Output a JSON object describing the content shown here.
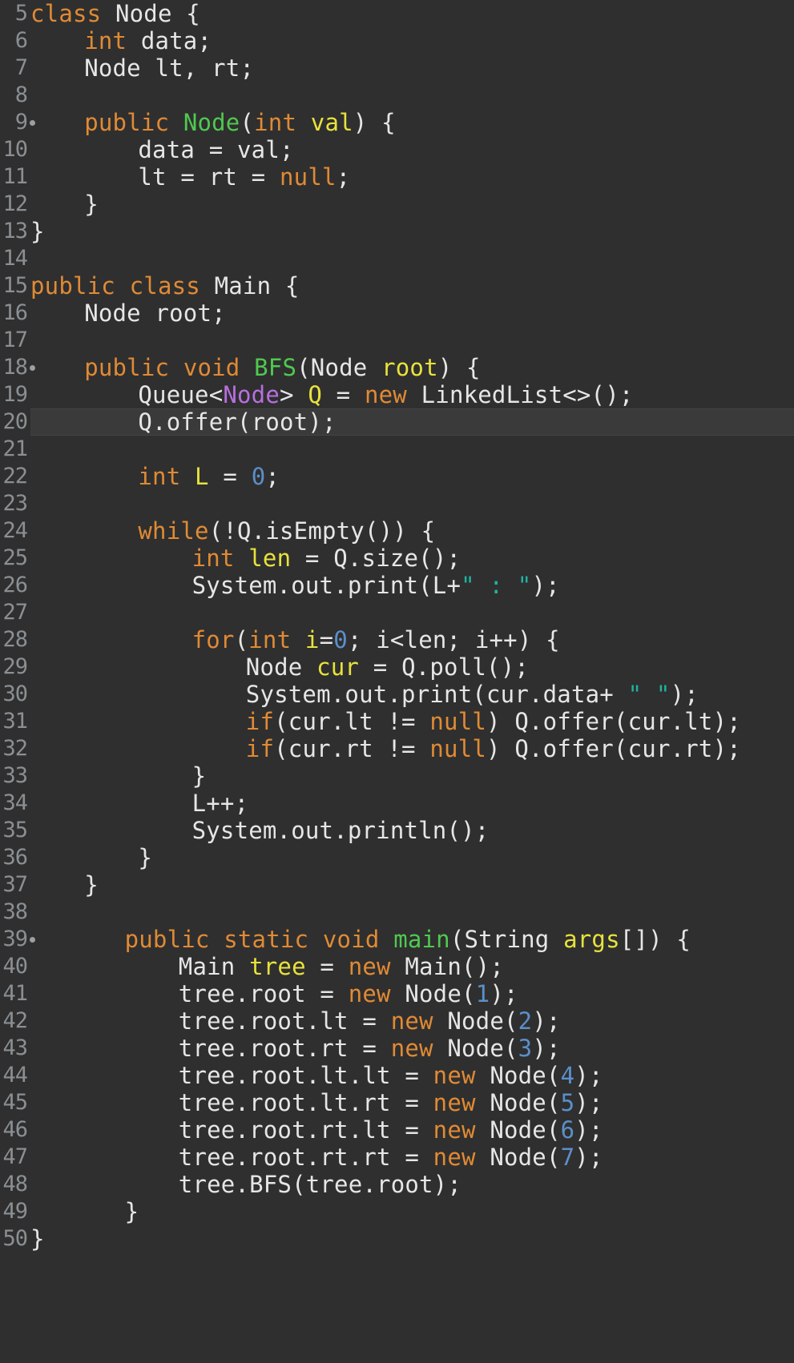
{
  "app": "code-editor",
  "colors": {
    "background": "#2f2f2f",
    "plain": "#e6e6e6",
    "keyword": "#e08a35",
    "method": "#4fc94f",
    "variable": "#e8e23c",
    "type": "#b86fe0",
    "number": "#5b8fc9",
    "string": "#20b2a0",
    "line_number": "#8a8f93"
  },
  "lines": [
    {
      "n": "5",
      "fold": false,
      "hl": false,
      "indent": 0,
      "tokens": [
        [
          "kw",
          "class"
        ],
        [
          "plain",
          " Node {"
        ]
      ]
    },
    {
      "n": "6",
      "fold": false,
      "hl": false,
      "indent": 4,
      "tokens": [
        [
          "kw",
          "int"
        ],
        [
          "plain",
          " data;"
        ]
      ]
    },
    {
      "n": "7",
      "fold": false,
      "hl": false,
      "indent": 4,
      "tokens": [
        [
          "plain",
          "Node lt, rt;"
        ]
      ]
    },
    {
      "n": "8",
      "fold": false,
      "hl": false,
      "indent": 0,
      "tokens": []
    },
    {
      "n": "9",
      "fold": true,
      "hl": false,
      "indent": 4,
      "tokens": [
        [
          "kw",
          "public"
        ],
        [
          "plain",
          " "
        ],
        [
          "method",
          "Node"
        ],
        [
          "plain",
          "("
        ],
        [
          "kw",
          "int"
        ],
        [
          "plain",
          " "
        ],
        [
          "var",
          "val"
        ],
        [
          "plain",
          ") {"
        ]
      ]
    },
    {
      "n": "10",
      "fold": false,
      "hl": false,
      "indent": 8,
      "tokens": [
        [
          "plain",
          "data = val;"
        ]
      ]
    },
    {
      "n": "11",
      "fold": false,
      "hl": false,
      "indent": 8,
      "tokens": [
        [
          "plain",
          "lt = rt = "
        ],
        [
          "kw",
          "null"
        ],
        [
          "plain",
          ";"
        ]
      ]
    },
    {
      "n": "12",
      "fold": false,
      "hl": false,
      "indent": 4,
      "tokens": [
        [
          "plain",
          "}"
        ]
      ]
    },
    {
      "n": "13",
      "fold": false,
      "hl": false,
      "indent": 0,
      "tokens": [
        [
          "plain",
          "}"
        ]
      ]
    },
    {
      "n": "14",
      "fold": false,
      "hl": false,
      "indent": 0,
      "tokens": []
    },
    {
      "n": "15",
      "fold": false,
      "hl": false,
      "indent": 0,
      "tokens": [
        [
          "kw",
          "public"
        ],
        [
          "plain",
          " "
        ],
        [
          "kw",
          "class"
        ],
        [
          "plain",
          " Main {"
        ]
      ]
    },
    {
      "n": "16",
      "fold": false,
      "hl": false,
      "indent": 4,
      "tokens": [
        [
          "plain",
          "Node root;"
        ]
      ]
    },
    {
      "n": "17",
      "fold": false,
      "hl": false,
      "indent": 0,
      "tokens": []
    },
    {
      "n": "18",
      "fold": true,
      "hl": false,
      "indent": 4,
      "tokens": [
        [
          "kw",
          "public"
        ],
        [
          "plain",
          " "
        ],
        [
          "kw",
          "void"
        ],
        [
          "plain",
          " "
        ],
        [
          "method",
          "BFS"
        ],
        [
          "plain",
          "(Node "
        ],
        [
          "var",
          "root"
        ],
        [
          "plain",
          ") {"
        ]
      ]
    },
    {
      "n": "19",
      "fold": false,
      "hl": false,
      "indent": 8,
      "tokens": [
        [
          "plain",
          "Queue<"
        ],
        [
          "type",
          "Node"
        ],
        [
          "plain",
          "> "
        ],
        [
          "var",
          "Q"
        ],
        [
          "plain",
          " = "
        ],
        [
          "kw",
          "new"
        ],
        [
          "plain",
          " LinkedList<>();"
        ]
      ]
    },
    {
      "n": "20",
      "fold": false,
      "hl": true,
      "indent": 8,
      "tokens": [
        [
          "plain",
          "Q.offer(root);"
        ]
      ]
    },
    {
      "n": "21",
      "fold": false,
      "hl": false,
      "indent": 0,
      "tokens": []
    },
    {
      "n": "22",
      "fold": false,
      "hl": false,
      "indent": 8,
      "tokens": [
        [
          "kw",
          "int"
        ],
        [
          "plain",
          " "
        ],
        [
          "var",
          "L"
        ],
        [
          "plain",
          " = "
        ],
        [
          "num",
          "0"
        ],
        [
          "plain",
          ";"
        ]
      ]
    },
    {
      "n": "23",
      "fold": false,
      "hl": false,
      "indent": 0,
      "tokens": []
    },
    {
      "n": "24",
      "fold": false,
      "hl": false,
      "indent": 8,
      "tokens": [
        [
          "kw",
          "while"
        ],
        [
          "plain",
          "(!Q.isEmpty()) {"
        ]
      ]
    },
    {
      "n": "25",
      "fold": false,
      "hl": false,
      "indent": 12,
      "tokens": [
        [
          "kw",
          "int"
        ],
        [
          "plain",
          " "
        ],
        [
          "var",
          "len"
        ],
        [
          "plain",
          " = Q.size();"
        ]
      ]
    },
    {
      "n": "26",
      "fold": false,
      "hl": false,
      "indent": 12,
      "tokens": [
        [
          "plain",
          "System.out.print(L+"
        ],
        [
          "str",
          "\" : \""
        ],
        [
          "plain",
          ");"
        ]
      ]
    },
    {
      "n": "27",
      "fold": false,
      "hl": false,
      "indent": 0,
      "tokens": []
    },
    {
      "n": "28",
      "fold": false,
      "hl": false,
      "indent": 12,
      "tokens": [
        [
          "kw",
          "for"
        ],
        [
          "plain",
          "("
        ],
        [
          "kw",
          "int"
        ],
        [
          "plain",
          " "
        ],
        [
          "var",
          "i"
        ],
        [
          "plain",
          "="
        ],
        [
          "num",
          "0"
        ],
        [
          "plain",
          "; i<len; i++) {"
        ]
      ]
    },
    {
      "n": "29",
      "fold": false,
      "hl": false,
      "indent": 16,
      "tokens": [
        [
          "plain",
          "Node "
        ],
        [
          "var",
          "cur"
        ],
        [
          "plain",
          " = Q.poll();"
        ]
      ]
    },
    {
      "n": "30",
      "fold": false,
      "hl": false,
      "indent": 16,
      "tokens": [
        [
          "plain",
          "System.out.print(cur.data+ "
        ],
        [
          "str",
          "\" \""
        ],
        [
          "plain",
          ");"
        ]
      ]
    },
    {
      "n": "31",
      "fold": false,
      "hl": false,
      "indent": 16,
      "tokens": [
        [
          "kw",
          "if"
        ],
        [
          "plain",
          "(cur.lt != "
        ],
        [
          "kw",
          "null"
        ],
        [
          "plain",
          ") Q.offer(cur.lt);"
        ]
      ]
    },
    {
      "n": "32",
      "fold": false,
      "hl": false,
      "indent": 16,
      "tokens": [
        [
          "kw",
          "if"
        ],
        [
          "plain",
          "(cur.rt != "
        ],
        [
          "kw",
          "null"
        ],
        [
          "plain",
          ") Q.offer(cur.rt);"
        ]
      ]
    },
    {
      "n": "33",
      "fold": false,
      "hl": false,
      "indent": 12,
      "tokens": [
        [
          "plain",
          "}"
        ]
      ]
    },
    {
      "n": "34",
      "fold": false,
      "hl": false,
      "indent": 12,
      "tokens": [
        [
          "plain",
          "L++;"
        ]
      ]
    },
    {
      "n": "35",
      "fold": false,
      "hl": false,
      "indent": 12,
      "tokens": [
        [
          "plain",
          "System.out.println();"
        ]
      ]
    },
    {
      "n": "36",
      "fold": false,
      "hl": false,
      "indent": 8,
      "tokens": [
        [
          "plain",
          "}"
        ]
      ]
    },
    {
      "n": "37",
      "fold": false,
      "hl": false,
      "indent": 4,
      "tokens": [
        [
          "plain",
          "}"
        ]
      ]
    },
    {
      "n": "38",
      "fold": false,
      "hl": false,
      "indent": 0,
      "tokens": []
    },
    {
      "n": "39",
      "fold": true,
      "hl": false,
      "indent": 7,
      "tokens": [
        [
          "kw",
          "public"
        ],
        [
          "plain",
          " "
        ],
        [
          "kw",
          "static"
        ],
        [
          "plain",
          " "
        ],
        [
          "kw",
          "void"
        ],
        [
          "plain",
          " "
        ],
        [
          "method",
          "main"
        ],
        [
          "plain",
          "(String "
        ],
        [
          "var",
          "args"
        ],
        [
          "plain",
          "[]) {"
        ]
      ]
    },
    {
      "n": "40",
      "fold": false,
      "hl": false,
      "indent": 11,
      "tokens": [
        [
          "plain",
          "Main "
        ],
        [
          "var",
          "tree"
        ],
        [
          "plain",
          " = "
        ],
        [
          "kw",
          "new"
        ],
        [
          "plain",
          " Main();"
        ]
      ]
    },
    {
      "n": "41",
      "fold": false,
      "hl": false,
      "indent": 11,
      "tokens": [
        [
          "plain",
          "tree.root = "
        ],
        [
          "kw",
          "new"
        ],
        [
          "plain",
          " Node("
        ],
        [
          "num",
          "1"
        ],
        [
          "plain",
          ");"
        ]
      ]
    },
    {
      "n": "42",
      "fold": false,
      "hl": false,
      "indent": 11,
      "tokens": [
        [
          "plain",
          "tree.root.lt = "
        ],
        [
          "kw",
          "new"
        ],
        [
          "plain",
          " Node("
        ],
        [
          "num",
          "2"
        ],
        [
          "plain",
          ");"
        ]
      ]
    },
    {
      "n": "43",
      "fold": false,
      "hl": false,
      "indent": 11,
      "tokens": [
        [
          "plain",
          "tree.root.rt = "
        ],
        [
          "kw",
          "new"
        ],
        [
          "plain",
          " Node("
        ],
        [
          "num",
          "3"
        ],
        [
          "plain",
          ");"
        ]
      ]
    },
    {
      "n": "44",
      "fold": false,
      "hl": false,
      "indent": 11,
      "tokens": [
        [
          "plain",
          "tree.root.lt.lt = "
        ],
        [
          "kw",
          "new"
        ],
        [
          "plain",
          " Node("
        ],
        [
          "num",
          "4"
        ],
        [
          "plain",
          ");"
        ]
      ]
    },
    {
      "n": "45",
      "fold": false,
      "hl": false,
      "indent": 11,
      "tokens": [
        [
          "plain",
          "tree.root.lt.rt = "
        ],
        [
          "kw",
          "new"
        ],
        [
          "plain",
          " Node("
        ],
        [
          "num",
          "5"
        ],
        [
          "plain",
          ");"
        ]
      ]
    },
    {
      "n": "46",
      "fold": false,
      "hl": false,
      "indent": 11,
      "tokens": [
        [
          "plain",
          "tree.root.rt.lt = "
        ],
        [
          "kw",
          "new"
        ],
        [
          "plain",
          " Node("
        ],
        [
          "num",
          "6"
        ],
        [
          "plain",
          ");"
        ]
      ]
    },
    {
      "n": "47",
      "fold": false,
      "hl": false,
      "indent": 11,
      "tokens": [
        [
          "plain",
          "tree.root.rt.rt = "
        ],
        [
          "kw",
          "new"
        ],
        [
          "plain",
          " Node("
        ],
        [
          "num",
          "7"
        ],
        [
          "plain",
          ");"
        ]
      ]
    },
    {
      "n": "48",
      "fold": false,
      "hl": false,
      "indent": 11,
      "tokens": [
        [
          "plain",
          "tree.BFS(tree.root);"
        ]
      ]
    },
    {
      "n": "49",
      "fold": false,
      "hl": false,
      "indent": 7,
      "tokens": [
        [
          "plain",
          "}"
        ]
      ]
    },
    {
      "n": "50",
      "fold": false,
      "hl": false,
      "indent": 0,
      "tokens": [
        [
          "plain",
          "}"
        ]
      ]
    }
  ]
}
